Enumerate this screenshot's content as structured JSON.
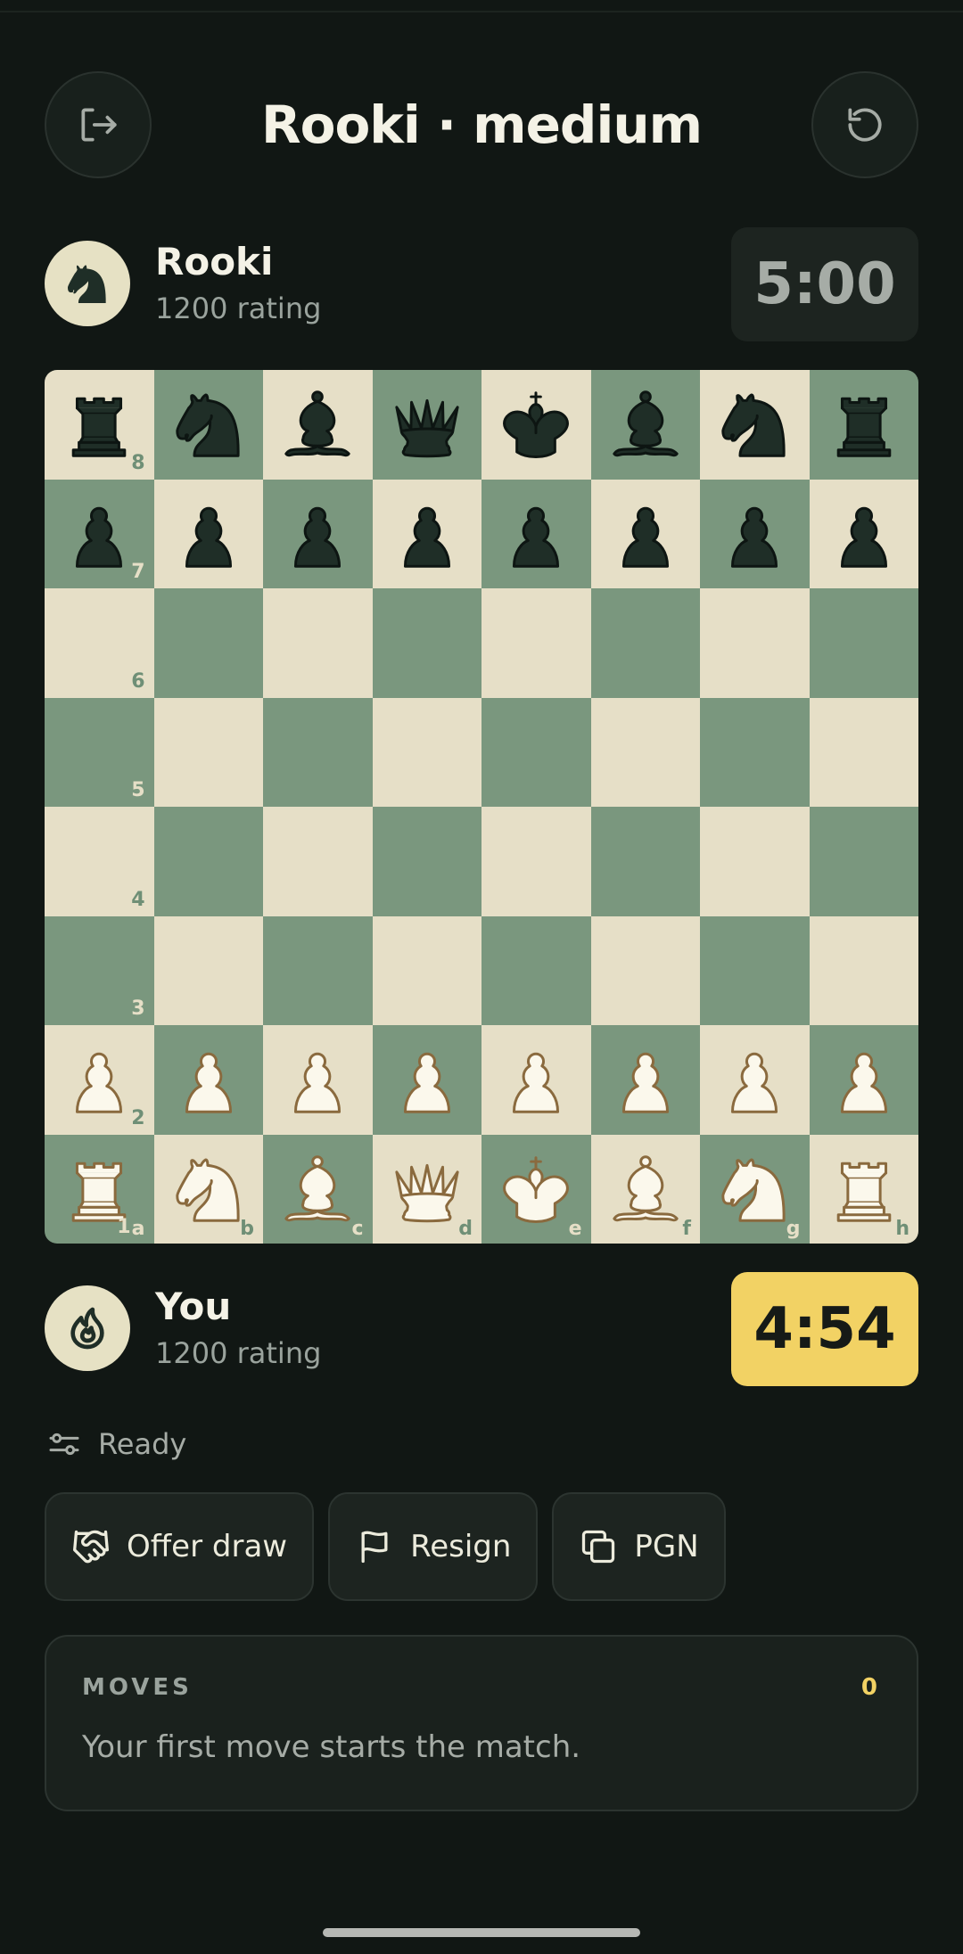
{
  "header": {
    "title": "Rooki · medium",
    "exit_icon": "exit-icon",
    "restart_icon": "restart-icon"
  },
  "opponent": {
    "name": "Rooki",
    "rating": "1200 rating",
    "clock": "5:00",
    "avatar_icon": "knight-icon"
  },
  "player": {
    "name": "You",
    "rating": "1200 rating",
    "clock": "4:54",
    "avatar_icon": "flame-icon"
  },
  "board": {
    "position": [
      [
        "br",
        "bn",
        "bb",
        "bq",
        "bk",
        "bb",
        "bn",
        "br"
      ],
      [
        "bp",
        "bp",
        "bp",
        "bp",
        "bp",
        "bp",
        "bp",
        "bp"
      ],
      [
        "",
        "",
        "",
        "",
        "",
        "",
        "",
        ""
      ],
      [
        "",
        "",
        "",
        "",
        "",
        "",
        "",
        ""
      ],
      [
        "",
        "",
        "",
        "",
        "",
        "",
        "",
        ""
      ],
      [
        "",
        "",
        "",
        "",
        "",
        "",
        "",
        ""
      ],
      [
        "wp",
        "wp",
        "wp",
        "wp",
        "wp",
        "wp",
        "wp",
        "wp"
      ],
      [
        "wr",
        "wn",
        "wb",
        "wq",
        "wk",
        "wb",
        "wn",
        "wr"
      ]
    ],
    "ranks": [
      "8",
      "7",
      "6",
      "5",
      "4",
      "3",
      "2",
      "1"
    ],
    "files": [
      "a",
      "b",
      "c",
      "d",
      "e",
      "f",
      "g",
      "h"
    ],
    "colors": {
      "light": "#e6dfc7",
      "dark": "#7a977e",
      "black_piece": "#1f2e27",
      "white_piece": "#fbf8ec"
    }
  },
  "status": {
    "text": "Ready",
    "icon": "sliders-icon"
  },
  "actions": {
    "offer_draw": "Offer draw",
    "resign": "Resign",
    "pgn": "PGN"
  },
  "moves": {
    "label": "MOVES",
    "count": "0",
    "empty_text": "Your first move starts the match."
  },
  "theme": {
    "accent": "#f2d264",
    "background": "#111714"
  }
}
